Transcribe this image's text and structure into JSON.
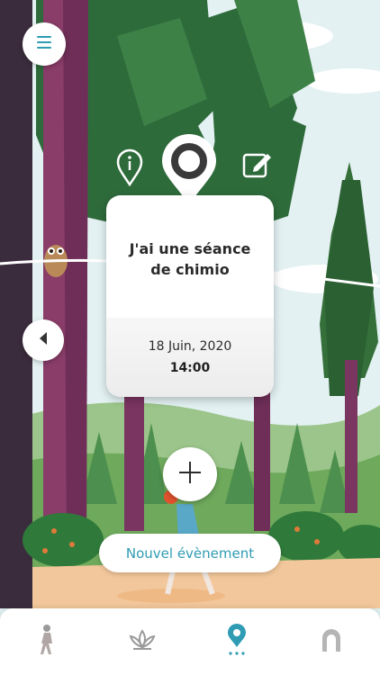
{
  "event": {
    "title": "J'ai une séance de chimio",
    "date": "18 Juin, 2020",
    "time": "14:00"
  },
  "actions": {
    "new_event_label": "Nouvel évènement"
  },
  "icons": {
    "menu": "menu-icon",
    "back": "chevron-left-icon",
    "info": "info-pin-icon",
    "location": "location-pin-icon",
    "edit": "edit-icon",
    "add": "plus-icon"
  },
  "tabbar": {
    "tabs": [
      {
        "name": "walker",
        "icon": "walker-icon",
        "active": false
      },
      {
        "name": "lotus",
        "icon": "lotus-icon",
        "active": false
      },
      {
        "name": "map-pin",
        "icon": "map-pin-icon",
        "active": true
      },
      {
        "name": "hood",
        "icon": "hood-icon",
        "active": false
      }
    ]
  },
  "colors": {
    "accent": "#2f9cb3",
    "inactive_icon": "#9a9a9a",
    "trunk": "#7a3560",
    "pine_dark": "#2e6b3b",
    "pine_light": "#4a9150",
    "sky": "#dfeff1"
  }
}
